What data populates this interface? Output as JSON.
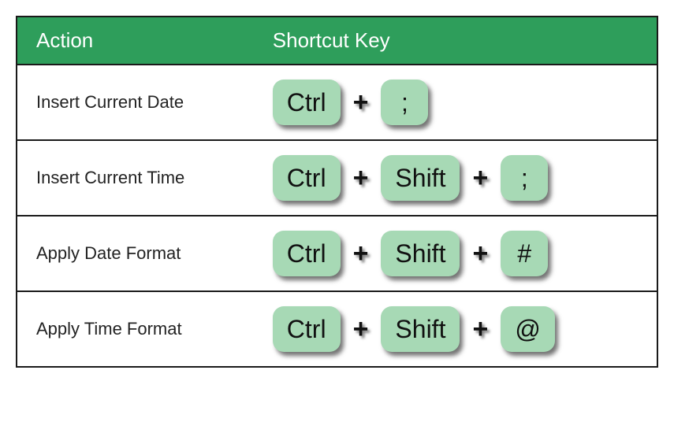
{
  "colors": {
    "header_bg": "#2e9e5b",
    "key_bg": "#a7d9b5",
    "border": "#1a1a1a"
  },
  "headers": {
    "action": "Action",
    "shortcut": "Shortcut Key"
  },
  "plus": "+",
  "rows": [
    {
      "action": "Insert Current Date",
      "keys": [
        "Ctrl",
        ";"
      ]
    },
    {
      "action": "Insert Current Time",
      "keys": [
        "Ctrl",
        "Shift",
        ";"
      ]
    },
    {
      "action": "Apply Date Format",
      "keys": [
        "Ctrl",
        "Shift",
        "#"
      ]
    },
    {
      "action": "Apply Time Format",
      "keys": [
        "Ctrl",
        "Shift",
        "@"
      ]
    }
  ]
}
